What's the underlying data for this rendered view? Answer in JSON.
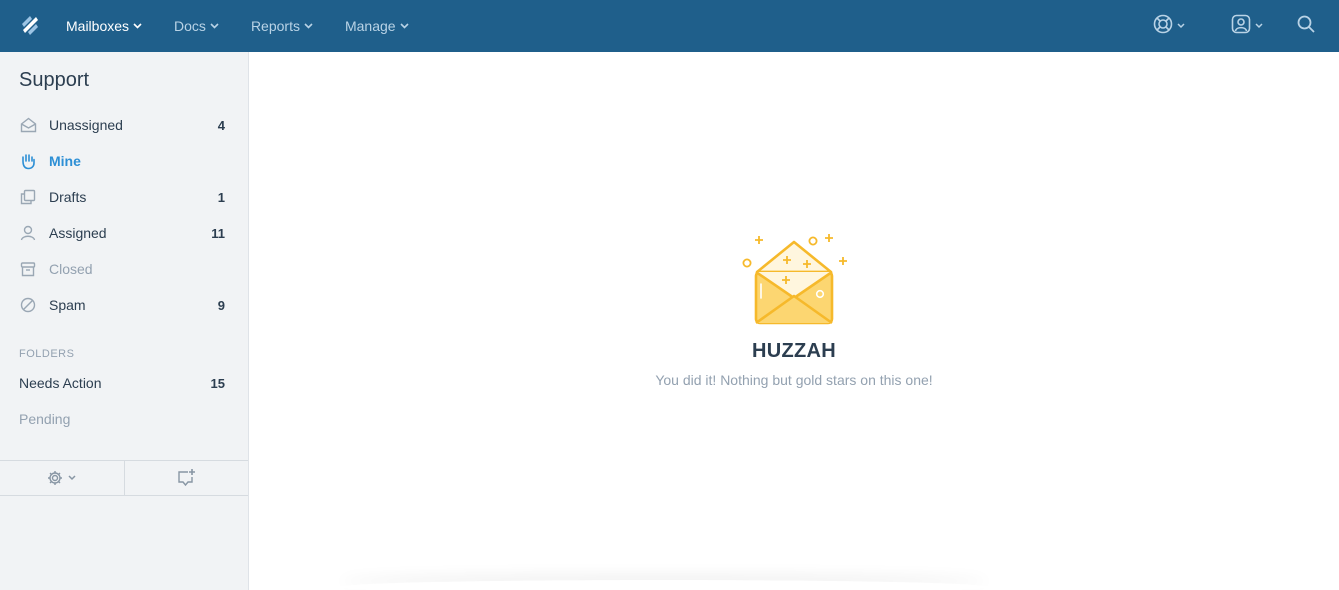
{
  "nav": {
    "items": [
      {
        "label": "Mailboxes",
        "active": true
      },
      {
        "label": "Docs",
        "active": false
      },
      {
        "label": "Reports",
        "active": false
      },
      {
        "label": "Manage",
        "active": false
      }
    ],
    "right_icons": [
      "help-lifebuoy-icon",
      "profile-icon",
      "search-icon"
    ]
  },
  "sidebar": {
    "mailbox_name": "Support",
    "folders": [
      {
        "label": "Unassigned",
        "count": "4",
        "icon": "envelope-open-icon"
      },
      {
        "label": "Mine",
        "count": "",
        "icon": "hand-icon",
        "active": true
      },
      {
        "label": "Drafts",
        "count": "1",
        "icon": "drafts-icon"
      },
      {
        "label": "Assigned",
        "count": "11",
        "icon": "person-icon"
      },
      {
        "label": "Closed",
        "count": "",
        "icon": "archive-icon",
        "muted": true
      },
      {
        "label": "Spam",
        "count": "9",
        "icon": "spam-icon"
      }
    ],
    "section_label": "FOLDERS",
    "custom_folders": [
      {
        "label": "Needs Action",
        "count": "15"
      },
      {
        "label": "Pending",
        "count": "",
        "muted": true
      }
    ],
    "footer": {
      "settings_icon": "gear-icon",
      "new_conversation_icon": "new-conversation-icon"
    }
  },
  "empty_state": {
    "title": "HUZZAH",
    "subtitle": "You did it! Nothing but gold stars on this one!",
    "illustration": "gold-envelope-icon"
  },
  "colors": {
    "topbar": "#1f5f8b",
    "accent": "#2d8fd5",
    "gold": "#f6b92b",
    "sidebar_bg": "#f1f3f5"
  }
}
